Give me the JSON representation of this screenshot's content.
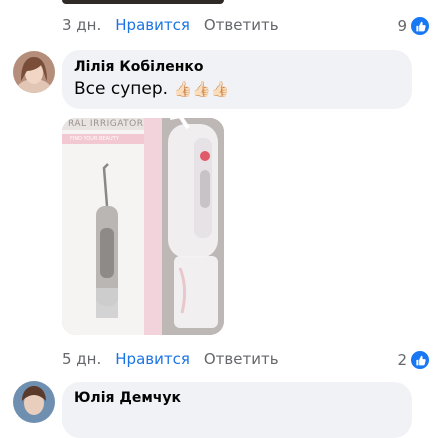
{
  "comment_top": {
    "time": "3 дн.",
    "like_label": "Нравится",
    "reply_label": "Ответить",
    "reactions_count": "9",
    "reaction_icon": "thumbs-up-icon"
  },
  "comment_1": {
    "author": "Лілія Кобіленко",
    "text": "Все супер.",
    "emoji": "👍🏻👍🏻👍🏻",
    "photo": {
      "box_text_line1": "RAL IRRIGATOR",
      "box_text_line2": "FIND YOUR BEAUTY"
    },
    "time": "5 дн.",
    "like_label": "Нравится",
    "reply_label": "Ответить",
    "reactions_count": "2",
    "reaction_icon": "thumbs-up-icon"
  },
  "comment_2": {
    "author": "Юлія Демчук"
  },
  "colors": {
    "accent": "#1b74e4",
    "muted": "#65676b",
    "bubble": "#f0f2f5"
  }
}
